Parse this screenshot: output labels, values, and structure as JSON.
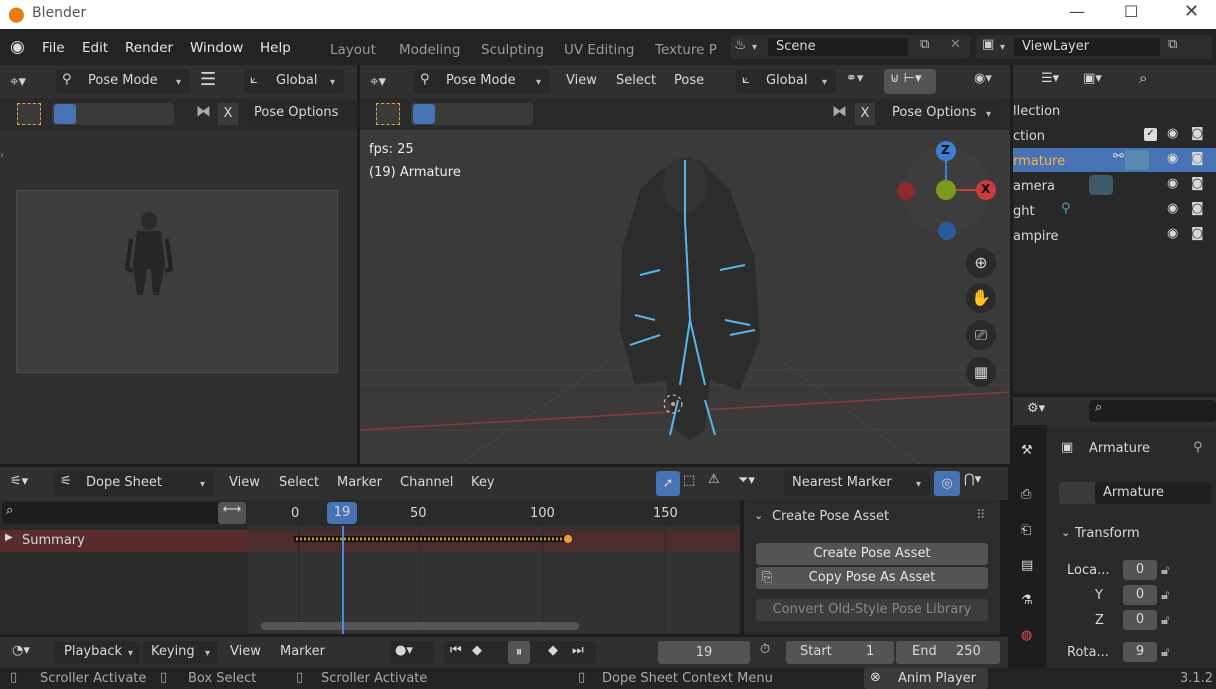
{
  "app": {
    "title": "Blender",
    "version": "3.1.2"
  },
  "menu": [
    "File",
    "Edit",
    "Render",
    "Window",
    "Help"
  ],
  "workspaces": [
    "Layout",
    "Modeling",
    "Sculpting",
    "UV Editing",
    "Texture P"
  ],
  "scene": "Scene",
  "view_layer": "ViewLayer",
  "left_editor": {
    "mode": "Pose Mode",
    "orientation": "Global",
    "pose_options": "Pose Options"
  },
  "viewport": {
    "mode": "Pose Mode",
    "menus": [
      "View",
      "Select",
      "Pose"
    ],
    "orientation": "Global",
    "pose_options": "Pose Options",
    "fps": "fps: 25",
    "object": "(19) Armature",
    "axis_z": "Z",
    "axis_x": "X",
    "x_color": "#cc3b3b",
    "z_color": "#3f7fd1",
    "y_color": "#7a9a1e"
  },
  "outliner": {
    "collection": "llection",
    "items": [
      "ction",
      "rmature",
      "amera",
      "ght",
      "ampire"
    ]
  },
  "props": {
    "object": "Armature",
    "data": "Armature",
    "transform": "Transform",
    "rows": [
      {
        "label": "Loca...",
        "value": "0"
      },
      {
        "label": "Y",
        "value": "0"
      },
      {
        "label": "Z",
        "value": "0"
      },
      {
        "label": "Rota...",
        "value": "9"
      }
    ]
  },
  "dopesheet": {
    "mode": "Dope Sheet",
    "menus": [
      "View",
      "Select",
      "Marker",
      "Channel",
      "Key"
    ],
    "snap": "Nearest Marker",
    "summary": "Summary",
    "ticks": [
      "0",
      "50",
      "100",
      "150"
    ],
    "current": "19"
  },
  "pose_panel": {
    "title": "Create Pose Asset",
    "create": "Create Pose Asset",
    "copy": "Copy Pose As Asset",
    "convert": "Convert Old-Style Pose Library"
  },
  "timeline": {
    "playback": "Playback",
    "keying": "Keying",
    "view": "View",
    "marker": "Marker",
    "frame": "19",
    "start_label": "Start",
    "start": "1",
    "end_label": "End",
    "end": "250"
  },
  "status": {
    "s1": "Scroller Activate",
    "s2": "Box Select",
    "s3": "Scroller Activate",
    "s4": "Dope Sheet Context Menu",
    "s5": "Anim Player"
  }
}
